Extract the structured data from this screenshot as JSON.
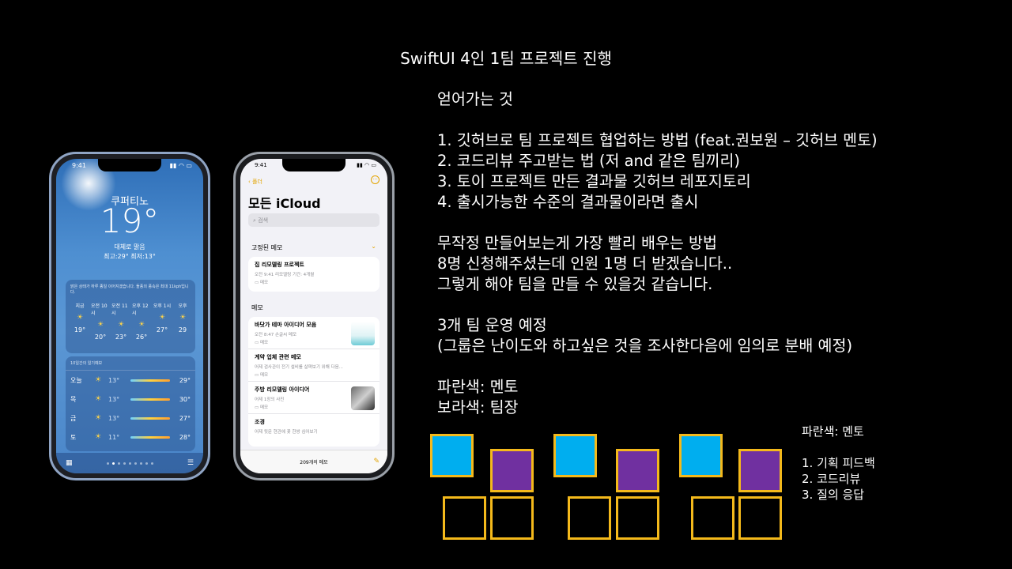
{
  "slide": {
    "title": "SwiftUI 4인 1팀 프로젝트 진행",
    "main_lines": [
      "얻어가는 것",
      "",
      "1. 깃허브로 팀 프로젝트 협업하는 방법 (feat.권보원 – 깃허브 멘토)",
      "2. 코드리뷰 주고받는 법 (저 and 같은 팀끼리)",
      "3. 토이 프로젝트 만든 결과물 깃허브 레포지토리",
      "4. 출시가능한 수준의 결과물이라면 출시",
      "",
      "무작정 만들어보는게 가장 빨리 배우는 방법",
      "8명 신청해주셨는데 인원 1명 더 받겠습니다..",
      "그렇게 해야 팀을 만들 수 있을것 같습니다.",
      "",
      "3개 팀 운영 예정",
      "(그룹은 난이도와 하고싶은 것을 조사한다음에 임의로 분배 예정)",
      "",
      "파란색: 멘토",
      "보라색: 팀장"
    ],
    "side_lines": [
      "파란색: 멘토",
      "",
      "1. 기획 피드백",
      "2. 코드리뷰",
      "3. 질의 응답"
    ],
    "colors": {
      "mentor": "#00aeef",
      "leader": "#7030a0",
      "border": "#f4b91b"
    },
    "teams": [
      {
        "top": [
          "mentor",
          "leader"
        ],
        "bottom": [
          "empty",
          "empty"
        ]
      },
      {
        "top": [
          "mentor",
          "leader"
        ],
        "bottom": [
          "empty",
          "empty"
        ]
      },
      {
        "top": [
          "mentor",
          "leader"
        ],
        "bottom": [
          "empty",
          "empty"
        ]
      }
    ]
  },
  "weather": {
    "time": "9:41",
    "city": "쿠퍼티노",
    "temp": "19°",
    "condition": "대체로 맑음",
    "hilo": "최고:29° 최저:13°",
    "desc": "맑은 상태가 하루 종일 이어지겠습니다. 돌풍의 풍속은 최대 11kph입니다.",
    "hours": [
      {
        "label": "지금",
        "temp": "19°"
      },
      {
        "label": "오전 10시",
        "temp": "20°"
      },
      {
        "label": "오전 11시",
        "temp": "23°"
      },
      {
        "label": "오후 12시",
        "temp": "26°"
      },
      {
        "label": "오후 1시",
        "temp": "27°"
      },
      {
        "label": "오후",
        "temp": "29"
      }
    ],
    "forecast_title": "10일간의 일기예보",
    "days": [
      {
        "day": "오늘",
        "lo": "13°",
        "hi": "29°"
      },
      {
        "day": "목",
        "lo": "13°",
        "hi": "30°"
      },
      {
        "day": "금",
        "lo": "13°",
        "hi": "27°"
      },
      {
        "day": "토",
        "lo": "11°",
        "hi": "28°"
      }
    ]
  },
  "notes": {
    "time": "9:41",
    "back": "폴더",
    "title": "모든 iCloud",
    "search_placeholder": "검색",
    "pinned_header": "고정된 메모",
    "notes_header": "메모",
    "pinned": [
      {
        "title": "집 리모델링 프로젝트",
        "sub": "오전 9:41  리모델링 기간: 4개월",
        "folder": "메모"
      }
    ],
    "items": [
      {
        "title": "바닷가 테마 아이디어 모음",
        "sub": "오전 8:47  손글씨 메모",
        "folder": "메모",
        "thumb": "beach"
      },
      {
        "title": "계약 업체 관련 메모",
        "sub": "어제  검사관이 전기 설비를 살펴보기 위해 다음...",
        "folder": "메모",
        "thumb": ""
      },
      {
        "title": "주방 리모델링 아이디어",
        "sub": "어제  1장의 사진",
        "folder": "메모",
        "thumb": "kitchen"
      },
      {
        "title": "조경",
        "sub": "어제  뒷문 현관에 꽃 한쌍 심어보기",
        "folder": "",
        "thumb": ""
      }
    ],
    "count": "209개의 메모"
  }
}
